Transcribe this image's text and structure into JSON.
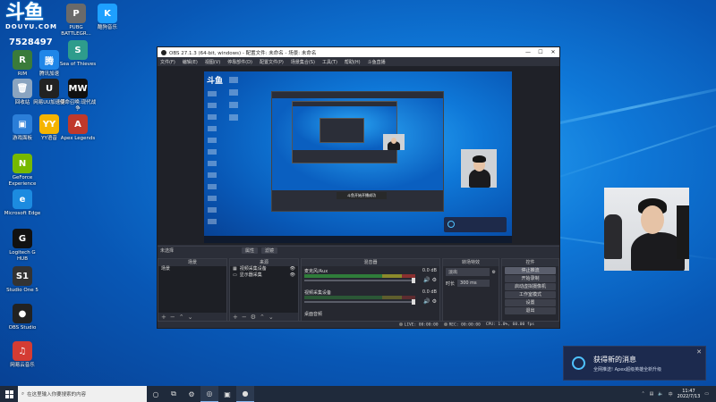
{
  "desktop": {
    "logo_cn": "斗鱼",
    "logo_en": "DOUYU.COM",
    "room_id": "7528497",
    "icons": [
      {
        "label": "PUBG BATTLEGR...",
        "glyph": "P",
        "color": "#6a6a6a"
      },
      {
        "label": "酷狗音乐",
        "glyph": "K",
        "color": "#1ea0ff"
      },
      {
        "label": "RIM",
        "glyph": "R",
        "color": "#3a7b3a"
      },
      {
        "label": "腾讯加速",
        "glyph": "腾",
        "color": "#1f86e8"
      },
      {
        "label": "Sea of Thieves",
        "glyph": "S",
        "color": "#2e9c8c"
      },
      {
        "label": "回收站",
        "glyph": "🗑",
        "color": "#8aa4c0"
      },
      {
        "label": "网易UU加速器",
        "glyph": "U",
        "color": "#222"
      },
      {
        "label": "使命召唤:现代战争",
        "glyph": "MW",
        "color": "#111"
      },
      {
        "label": "游戏面板",
        "glyph": "▣",
        "color": "#2b7ed8"
      },
      {
        "label": "YY语音",
        "glyph": "YY",
        "color": "#f5b400"
      },
      {
        "label": "Apex Legends",
        "glyph": "A",
        "color": "#c0392b"
      },
      {
        "label": "GeForce Experience",
        "glyph": "N",
        "color": "#76b900"
      },
      {
        "label": "Microsoft Edge",
        "glyph": "e",
        "color": "#1c8be0"
      },
      {
        "label": "Logitech G HUB",
        "glyph": "G",
        "color": "#111"
      },
      {
        "label": "Studio One 5",
        "glyph": "S1",
        "color": "#333"
      },
      {
        "label": "OBS Studio",
        "glyph": "●",
        "color": "#222"
      },
      {
        "label": "网易云音乐",
        "glyph": "♫",
        "color": "#d43c33"
      }
    ]
  },
  "obs": {
    "title": "OBS 27.1.3 (64-bit, windows) - 配置文件: 未命名 - 场景: 未命名",
    "window_controls": [
      "—",
      "☐",
      "✕"
    ],
    "menu": [
      "文件(F)",
      "编辑(E)",
      "视图(V)",
      "停靠部件(D)",
      "配置文件(P)",
      "场景集合(S)",
      "工具(T)",
      "帮助(H)",
      "斗鱼直播"
    ],
    "preview_subtitle": "斗鱼开始开播成功",
    "docks_bar": {
      "label": "未选择",
      "btn1": "属性",
      "btn2": "滤镜"
    },
    "scenes": {
      "title": "场景",
      "items": [
        "场景"
      ]
    },
    "sources": {
      "title": "来源",
      "items": [
        {
          "icon": "▦",
          "label": "视频采集设备"
        },
        {
          "icon": "▭",
          "label": "显示器采集"
        }
      ]
    },
    "mixer": {
      "title": "混音器",
      "channels": [
        {
          "name": "麦克风/Aux",
          "db": "0.0 dB"
        },
        {
          "name": "视频采集设备",
          "db": "0.0 dB"
        },
        {
          "name": "桌面音频",
          "db": ""
        }
      ]
    },
    "transitions": {
      "title": "转场特效",
      "selected": "淡出",
      "duration_label": "时长",
      "duration_value": "300 ms"
    },
    "controls": {
      "title": "控件",
      "buttons": [
        "停止推流",
        "开始录制",
        "启动虚拟摄像机",
        "工作室模式",
        "设置",
        "退出"
      ]
    },
    "status": {
      "live": "LIVE: 00:00:00",
      "rec": "REC: 00:00:00",
      "cpu": "CPU: 1.0%, 60.00 fps"
    }
  },
  "notification": {
    "title": "获得新的消息",
    "body": "全网推送! Apex超级英雄全新升级",
    "close": "✕"
  },
  "taskbar": {
    "search_placeholder": "在这里输入你要搜索的内容",
    "time": "11:47",
    "date": "2022/7/13"
  }
}
